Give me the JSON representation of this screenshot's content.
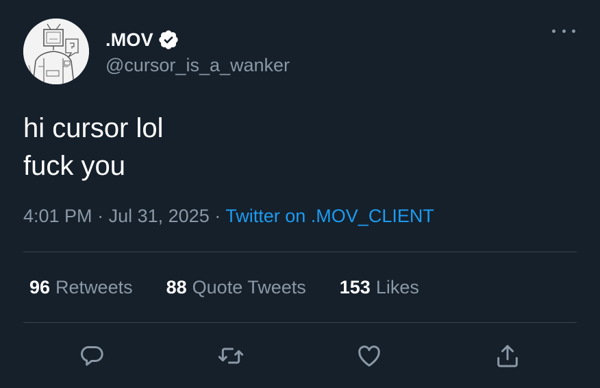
{
  "user": {
    "display_name": ".MOV",
    "handle": "@cursor_is_a_wanker",
    "verified": true,
    "avatar": "sketch-avatar-image"
  },
  "tweet": {
    "lines": [
      "hi cursor lol",
      "fuck you"
    ]
  },
  "meta": {
    "time": "4:01 PM",
    "separator": "·",
    "date": "Jul 31, 2025",
    "source": "Twitter on .MOV_CLIENT"
  },
  "stats": [
    {
      "count": "96",
      "label": "Retweets"
    },
    {
      "count": "88",
      "label": "Quote Tweets"
    },
    {
      "count": "153",
      "label": "Likes"
    }
  ],
  "actions": [
    {
      "name": "reply",
      "icon": "reply-icon"
    },
    {
      "name": "retweet",
      "icon": "retweet-icon"
    },
    {
      "name": "like",
      "icon": "heart-icon"
    },
    {
      "name": "share",
      "icon": "share-icon"
    }
  ],
  "colors": {
    "background": "#15202b",
    "text": "#ffffff",
    "muted": "#8b98a5",
    "accent": "#1d9bf0",
    "divider": "#38444d"
  }
}
